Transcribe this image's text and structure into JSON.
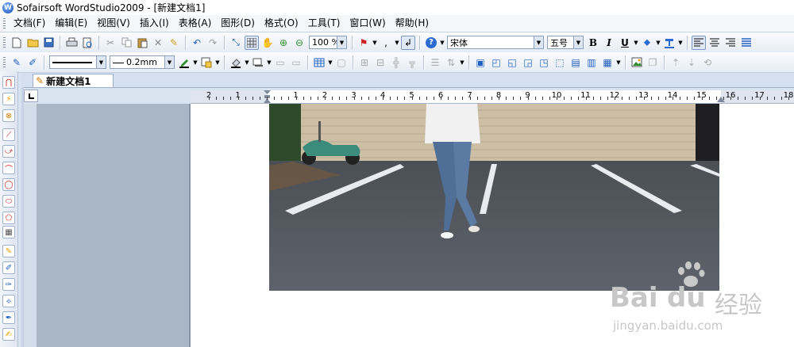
{
  "window": {
    "title": "Sofairsoft WordStudio2009 - [新建文档1]"
  },
  "menu": [
    "文档(F)",
    "编辑(E)",
    "视图(V)",
    "插入(I)",
    "表格(A)",
    "图形(D)",
    "格式(O)",
    "工具(T)",
    "窗口(W)",
    "帮助(H)"
  ],
  "toolbar1": {
    "zoom": "100 %",
    "font_name": "宋体",
    "font_size": "五号",
    "bold": "B",
    "italic": "I",
    "underline": "U"
  },
  "toolbar2": {
    "line_width": "0.2mm"
  },
  "tabs": [
    "新建文档1"
  ],
  "ruler": {
    "labels": [
      "2",
      "1",
      "1",
      "2",
      "3",
      "4",
      "5",
      "6",
      "7",
      "8",
      "9",
      "10",
      "11",
      "12",
      "13",
      "14",
      "15",
      "16",
      "17",
      "18"
    ]
  },
  "watermark": {
    "brand": "Bai",
    "brand2": "du",
    "cn": "经验",
    "url": "jingyan.baidu.com"
  },
  "colors": {
    "accent": "#1f5fbf",
    "margin_panel": "#a8b6c6",
    "toolbar_bg": "#e6ecf5"
  }
}
